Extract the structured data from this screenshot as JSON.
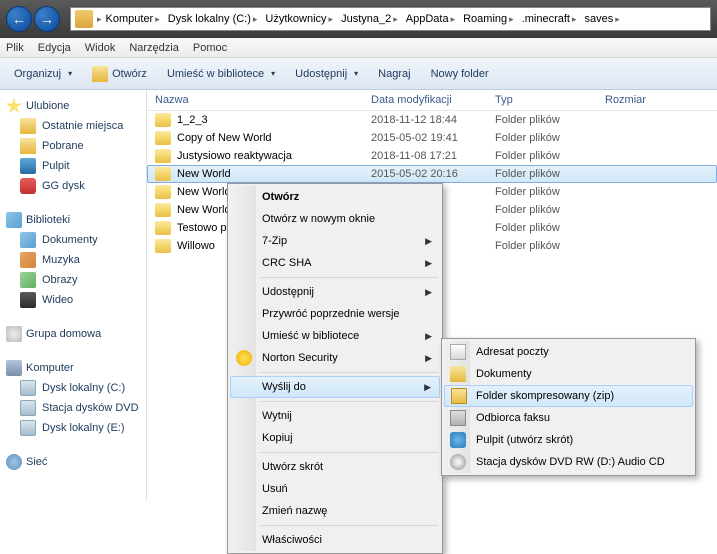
{
  "breadcrumb": [
    "Komputer",
    "Dysk lokalny (C:)",
    "Użytkownicy",
    "Justyna_2",
    "AppData",
    "Roaming",
    ".minecraft",
    "saves"
  ],
  "menubar": {
    "plik": "Plik",
    "edycja": "Edycja",
    "widok": "Widok",
    "narzedzia": "Narzędzia",
    "pomoc": "Pomoc"
  },
  "toolbar": {
    "organizuj": "Organizuj",
    "otworz": "Otwórz",
    "umiesc": "Umieść w bibliotece",
    "udostepnij": "Udostępnij",
    "nagraj": "Nagraj",
    "nowy_folder": "Nowy folder"
  },
  "sidebar": {
    "ulubione": {
      "label": "Ulubione",
      "items": [
        "Ostatnie miejsca",
        "Pobrane",
        "Pulpit",
        "GG dysk"
      ]
    },
    "biblioteki": {
      "label": "Biblioteki",
      "items": [
        "Dokumenty",
        "Muzyka",
        "Obrazy",
        "Wideo"
      ]
    },
    "grupa": {
      "label": "Grupa domowa"
    },
    "komputer": {
      "label": "Komputer",
      "items": [
        "Dysk lokalny (C:)",
        "Stacja dysków DVD",
        "Dysk lokalny (E:)"
      ]
    },
    "siec": {
      "label": "Sieć"
    }
  },
  "columns": {
    "nazwa": "Nazwa",
    "data": "Data modyfikacji",
    "typ": "Typ",
    "rozmiar": "Rozmiar"
  },
  "rows": [
    {
      "name": "1_2_3",
      "date": "2018-11-12 18:44",
      "type": "Folder plików"
    },
    {
      "name": "Copy of New World",
      "date": "2015-05-02 19:41",
      "type": "Folder plików"
    },
    {
      "name": "Justysiowo reaktywacja",
      "date": "2018-11-08 17:21",
      "type": "Folder plików"
    },
    {
      "name": "New World",
      "date": "2015-05-02 20:16",
      "type": "Folder plików"
    },
    {
      "name": "New World-",
      "date": "",
      "type": "Folder plików"
    },
    {
      "name": "New World--",
      "date": "",
      "type": "Folder plików"
    },
    {
      "name": "Testowo pod Poz",
      "date": "",
      "type": "Folder plików"
    },
    {
      "name": "Willowo",
      "date": "",
      "type": "Folder plików"
    }
  ],
  "context1": {
    "otworz": "Otwórz",
    "otworz_nowe": "Otwórz w nowym oknie",
    "zip7": "7-Zip",
    "crc": "CRC SHA",
    "udostepnij": "Udostępnij",
    "przywroc": "Przywróć poprzednie wersje",
    "umiesc": "Umieść w bibliotece",
    "norton": "Norton Security",
    "wyslij": "Wyślij do",
    "wytnij": "Wytnij",
    "kopiuj": "Kopiuj",
    "skrot": "Utwórz skrót",
    "usun": "Usuń",
    "zmien": "Zmień nazwę",
    "wlasciwosci": "Właściwości"
  },
  "context2": {
    "adresat": "Adresat poczty",
    "dokumenty": "Dokumenty",
    "folder_zip": "Folder skompresowany (zip)",
    "faks": "Odbiorca faksu",
    "pulpit": "Pulpit (utwórz skrót)",
    "dvd": "Stacja dysków DVD RW (D:) Audio CD"
  }
}
